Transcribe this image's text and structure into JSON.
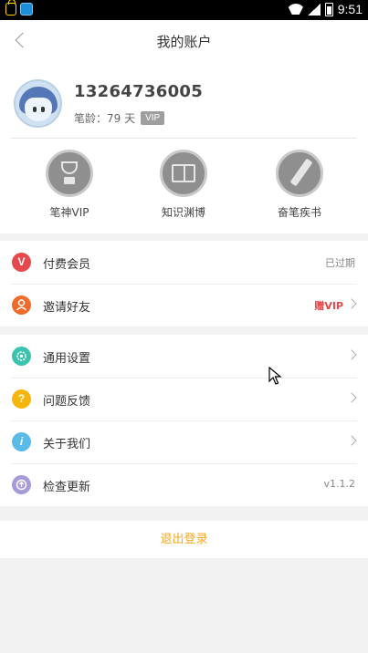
{
  "status_bar": {
    "time": "9:51",
    "icons": [
      "lock-icon",
      "app-icon",
      "wifi-icon",
      "signal-icon",
      "battery-icon"
    ]
  },
  "header": {
    "title": "我的账户",
    "back_icon": "chevron-left-icon"
  },
  "profile": {
    "phone": "13264736005",
    "pen_age_label": "笔龄：79 天",
    "vip_badge": "VIP",
    "features": [
      {
        "label": "笔神VIP",
        "icon": "trophy-icon"
      },
      {
        "label": "知识渊博",
        "icon": "book-icon"
      },
      {
        "label": "奋笔疾书",
        "icon": "pen-icon"
      }
    ]
  },
  "sections": [
    {
      "rows": [
        {
          "label": "付费会员",
          "icon": "vip-v-icon",
          "icon_color": "#e5484d",
          "value": "已过期",
          "chevron": false
        },
        {
          "label": "邀请好友",
          "icon": "person-icon",
          "icon_color": "#f06a2a",
          "value": "赠VIP",
          "value_color": "#e24a4a",
          "chevron": true
        }
      ]
    },
    {
      "rows": [
        {
          "label": "通用设置",
          "icon": "gear-icon",
          "icon_color": "#3bc3b0",
          "chevron": true
        },
        {
          "label": "问题反馈",
          "icon": "question-icon",
          "icon_color": "#f5b50a",
          "chevron": true
        },
        {
          "label": "关于我们",
          "icon": "info-icon",
          "icon_color": "#5bbbe8",
          "chevron": true
        },
        {
          "label": "检查更新",
          "icon": "update-icon",
          "icon_color": "#a79ad8",
          "value": "v1.1.2",
          "chevron": false
        }
      ]
    }
  ],
  "logout": {
    "label": "退出登录",
    "color": "#f5a623"
  },
  "colors": {
    "background": "#f2f2f2",
    "accent": "#f5a623",
    "red": "#e24a4a"
  }
}
